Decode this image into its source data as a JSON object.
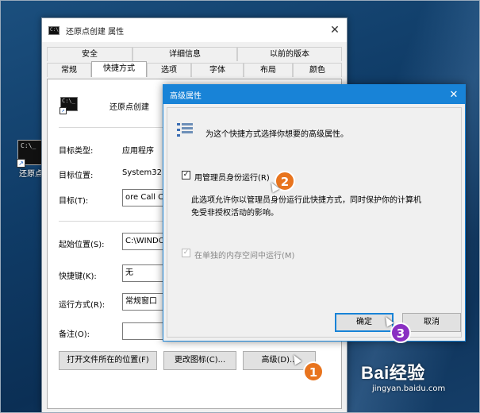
{
  "desktop": {
    "icon_label": "还原点"
  },
  "properties_window": {
    "title": "还原点创建 属性",
    "close_glyph": "✕",
    "tabs_top": [
      "安全",
      "详细信息",
      "以前的版本"
    ],
    "tabs_bottom": [
      "常规",
      "快捷方式",
      "选项",
      "字体",
      "布局",
      "颜色"
    ],
    "active_tab": "快捷方式",
    "shortcut_name": "还原点创建",
    "fields": {
      "target_type_label": "目标类型:",
      "target_type_value": "应用程序",
      "target_location_label": "目标位置:",
      "target_location_value": "System32",
      "target_label": "目标(T):",
      "target_value": "ore Call C",
      "start_in_label": "起始位置(S):",
      "start_in_value": "C:\\WINDO",
      "shortcut_key_label": "快捷键(K):",
      "shortcut_key_value": "无",
      "run_label": "运行方式(R):",
      "run_value": "常规窗口",
      "comment_label": "备注(O):",
      "comment_value": ""
    },
    "buttons": {
      "open_location": "打开文件所在的位置(F)",
      "change_icon": "更改图标(C)...",
      "advanced": "高级(D)..."
    }
  },
  "advanced_dialog": {
    "title": "高级属性",
    "close_glyph": "✕",
    "intro": "为这个快捷方式选择你想要的高级属性。",
    "run_as_admin_label": "用管理员身份运行(R)",
    "run_as_admin_checked": true,
    "description_line1": "此选项允许你以管理员身份运行此快捷方式，同时保护你的计算机",
    "description_line2": "免受非授权活动的影响。",
    "separate_memory_label": "在单独的内存空间中运行(M)",
    "separate_memory_checked": true,
    "separate_memory_enabled": false,
    "ok": "确定",
    "cancel": "取消"
  },
  "steps": [
    "1",
    "2",
    "3"
  ],
  "watermark": {
    "brand": "Bai经验",
    "url": "jingyan.baidu.com"
  },
  "colors": {
    "accent": "#1883d7",
    "badge_orange": "#e8741e",
    "badge_purple": "#8a2fc2"
  }
}
